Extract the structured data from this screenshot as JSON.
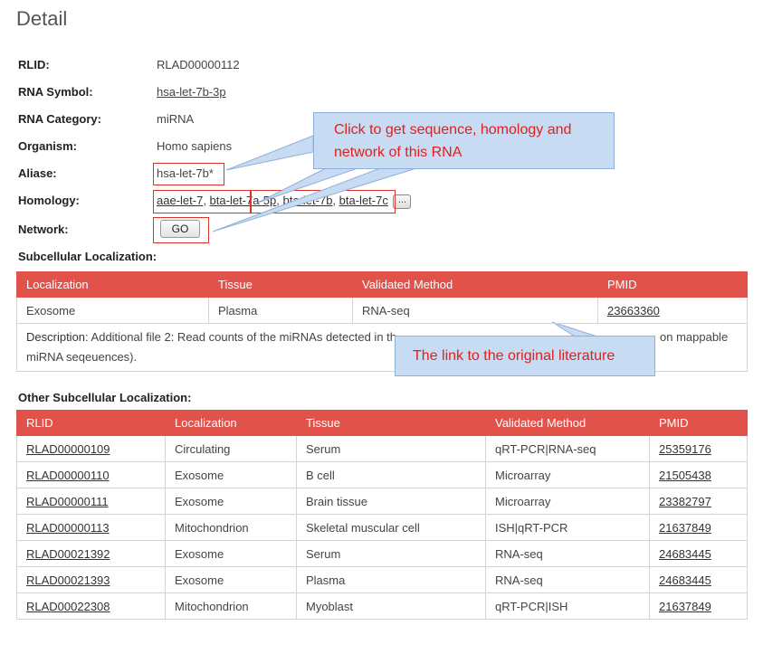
{
  "page": {
    "title": "Detail"
  },
  "detail": {
    "rlid": {
      "label": "RLID:",
      "value": "RLAD00000112"
    },
    "rna_symbol": {
      "label": "RNA Symbol:",
      "value": "hsa-let-7b-3p"
    },
    "rna_category": {
      "label": "RNA Category:",
      "value": "miRNA"
    },
    "organism": {
      "label": "Organism:",
      "value": "Homo sapiens"
    },
    "aliase": {
      "label": "Aliase:",
      "value": "hsa-let-7b*"
    },
    "homology": {
      "label": "Homology:",
      "items": [
        "aae-let-7",
        "bta-let-7a-5p",
        "bta-let-7b",
        "bta-let-7c"
      ],
      "separator": ", ",
      "more_label": "..."
    },
    "network": {
      "label": "Network:",
      "button": "GO"
    }
  },
  "subcellular": {
    "title": "Subcellular Localization:",
    "headers": [
      "Localization",
      "Tissue",
      "Validated Method",
      "PMID"
    ],
    "row": [
      "Exosome",
      "Plasma",
      "RNA-seq",
      "23663360"
    ],
    "description_label": "Description",
    "description_text": ": Additional file 2: Read counts of the miRNAs detected in th",
    "description_end": "on mappable",
    "description_line2": "miRNA seqeuences)."
  },
  "other": {
    "title": "Other Subcellular Localization:",
    "headers": [
      "RLID",
      "Localization",
      "Tissue",
      "Validated Method",
      "PMID"
    ],
    "rows": [
      [
        "RLAD00000109",
        "Circulating",
        "Serum",
        "qRT-PCR|RNA-seq",
        "25359176"
      ],
      [
        "RLAD00000110",
        "Exosome",
        "B cell",
        "Microarray",
        "21505438"
      ],
      [
        "RLAD00000111",
        "Exosome",
        "Brain tissue",
        "Microarray",
        "23382797"
      ],
      [
        "RLAD00000113",
        "Mitochondrion",
        "Skeletal muscular cell",
        "ISH|qRT-PCR",
        "21637849"
      ],
      [
        "RLAD00021392",
        "Exosome",
        "Serum",
        "RNA-seq",
        "24683445"
      ],
      [
        "RLAD00021393",
        "Exosome",
        "Plasma",
        "RNA-seq",
        "24683445"
      ],
      [
        "RLAD00022308",
        "Mitochondrion",
        "Myoblast",
        "qRT-PCR|ISH",
        "21637849"
      ]
    ]
  },
  "callouts": {
    "top": "Click to get sequence, homology and network of this RNA",
    "literature": "The link to the original literature"
  },
  "colors": {
    "table_header": "#e0524a",
    "highlight_border": "#d9322b",
    "callout_fill": "#c7dbf2",
    "callout_text": "#e0201b"
  }
}
